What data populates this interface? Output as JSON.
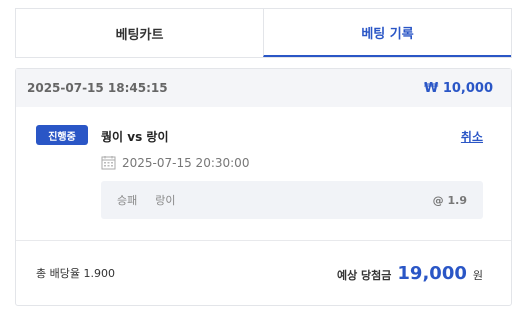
{
  "tabs": [
    {
      "label": "베팅카트",
      "active": false
    },
    {
      "label": "베팅 기록",
      "active": true
    }
  ],
  "record": {
    "timestamp": "2025-07-15 18:45:15",
    "amount": "₩ 10,000",
    "bet": {
      "status": "진행중",
      "match": "퀑이 vs 랑이",
      "cancel_label": "취소",
      "date": "2025-07-15 20:30:00",
      "market": "승패",
      "selection": "랑이",
      "odds": "@ 1.9"
    },
    "total_odds_label": "총 배당율 1.900",
    "expected_label": "예상 당첨금",
    "expected_value": "19,000",
    "expected_unit": "원"
  },
  "colors": {
    "accent": "#2a56c6",
    "bg_muted": "#f4f5f8"
  },
  "icons": {
    "date": "calendar-icon"
  }
}
